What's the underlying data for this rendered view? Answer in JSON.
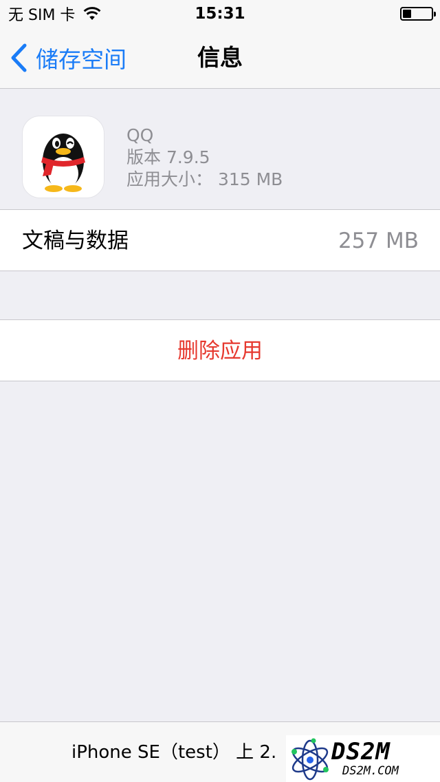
{
  "status_bar": {
    "carrier": "无 SIM 卡",
    "time": "15:31",
    "battery_level": 0.3
  },
  "nav": {
    "back_label": "储存空间",
    "title": "信息"
  },
  "app": {
    "name": "QQ",
    "version": "版本 7.9.5",
    "size": "应用大小： 315 MB",
    "icon": "qq-penguin-icon"
  },
  "documents": {
    "label": "文稿与数据",
    "value": "257 MB"
  },
  "delete_label": "删除应用",
  "bottom": {
    "usage": "iPhone SE（test） 上 2."
  },
  "watermark": {
    "title": "DS2M",
    "url": "DS2M.COM"
  },
  "colors": {
    "accent": "#1a7cf7",
    "destructive": "#e6392f",
    "secondary_text": "#8e8e93",
    "background": "#efeff4"
  }
}
